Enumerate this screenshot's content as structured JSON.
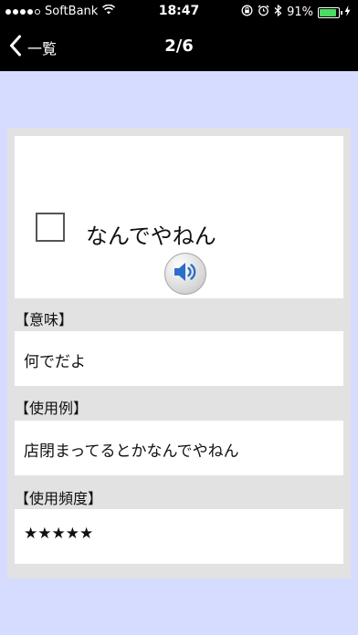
{
  "status": {
    "carrier": "SoftBank",
    "time": "18:47",
    "battery": "91%",
    "battery_level": 0.91,
    "icons": [
      "signal-dots-icon",
      "wifi-icon",
      "lock-rotation-icon",
      "alarm-icon",
      "bluetooth-icon",
      "battery-icon",
      "charging-icon"
    ]
  },
  "nav": {
    "back_label": "一覧",
    "title": "2/6"
  },
  "entry": {
    "word": "なんでやねん",
    "meaning_label": "【意味】",
    "meaning": "何でだよ",
    "example_label": "【使用例】",
    "example": "店閉まってるとかなんでやねん",
    "frequency_label": "【使用頻度】",
    "frequency": "★★★★★",
    "frequency_stars": 5
  },
  "colors": {
    "background": "#d6dcff",
    "bar": "#000000",
    "card": "#e2e2e2",
    "speaker_blue": "#2a6fc9"
  }
}
